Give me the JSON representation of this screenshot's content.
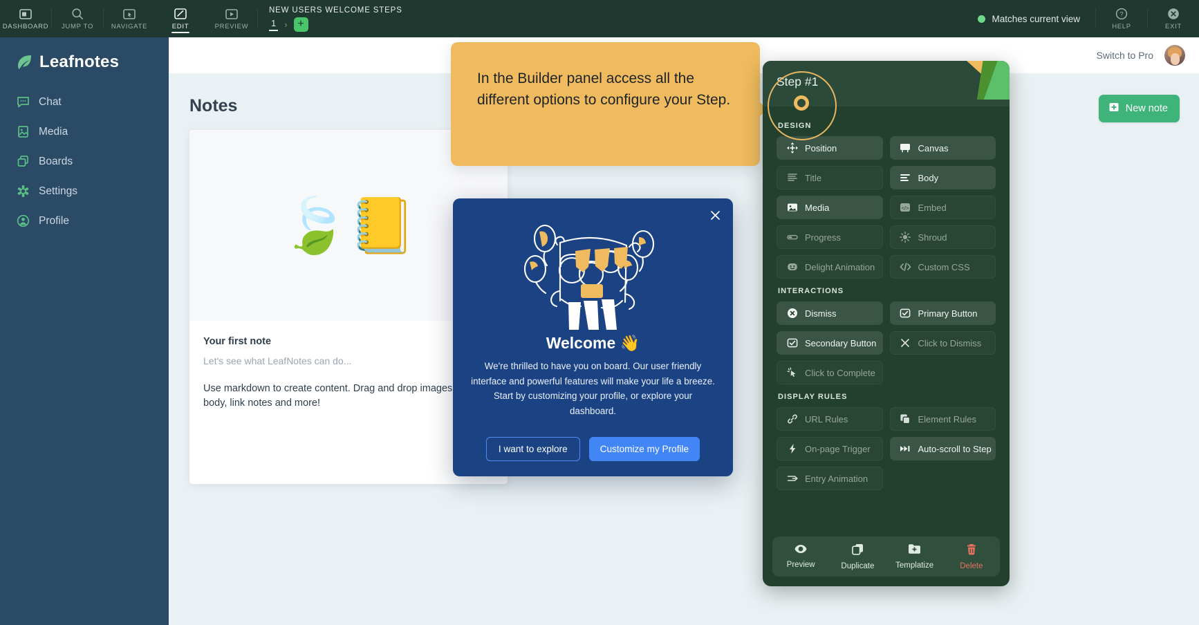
{
  "builder_bar": {
    "tools": [
      {
        "label": "DASHBOARD",
        "icon": "dashboard-icon",
        "active": false
      },
      {
        "label": "JUMP TO",
        "icon": "search-icon",
        "active": false
      },
      {
        "label": "NAVIGATE",
        "icon": "cursor-box-icon",
        "active": false
      },
      {
        "label": "EDIT",
        "icon": "pencil-box-icon",
        "active": true
      },
      {
        "label": "PREVIEW",
        "icon": "play-box-icon",
        "active": false
      }
    ],
    "flow_title": "NEW USERS WELCOME STEPS",
    "current_step": "1",
    "add_step_label": "+",
    "status_text": "Matches current view",
    "status_color": "#6fd88a",
    "help_label": "HELP",
    "exit_label": "EXIT"
  },
  "sidebar": {
    "brand": "Leafnotes",
    "items": [
      {
        "label": "Chat",
        "icon": "chat-icon"
      },
      {
        "label": "Media",
        "icon": "media-icon"
      },
      {
        "label": "Boards",
        "icon": "boards-icon"
      },
      {
        "label": "Settings",
        "icon": "settings-gear-icon"
      },
      {
        "label": "Profile",
        "icon": "profile-icon"
      }
    ]
  },
  "app_header": {
    "switch_to_pro": "Switch to Pro"
  },
  "main": {
    "page_title": "Notes",
    "new_note_label": "New note",
    "note_card": {
      "cover_emoji": "🍃📒",
      "title": "Your first note",
      "subtitle": "Let's see what LeafNotes can do...",
      "body": "Use markdown to create content. Drag and drop images in the body, link notes and more!"
    }
  },
  "callout": {
    "text": "In the Builder panel access all the different options to configure your Step.",
    "color": "#f0bb5e"
  },
  "welcome_modal": {
    "title": "Welcome 👋",
    "paragraph": "We're thrilled to have you on board. Our user friendly interface and powerful features will make your life a breeze. Start by customizing your profile, or explore your dashboard.",
    "secondary_button": "I want to explore",
    "primary_button": "Customize my Profile",
    "close_icon": "close-icon",
    "background": "#1b4384"
  },
  "builder_panel": {
    "step_label": "Step #1",
    "sections": [
      {
        "title": "DESIGN",
        "options": [
          {
            "label": "Position",
            "icon": "move-icon",
            "active": true
          },
          {
            "label": "Canvas",
            "icon": "canvas-icon",
            "active": true
          },
          {
            "label": "Title",
            "icon": "title-lines-icon",
            "active": false
          },
          {
            "label": "Body",
            "icon": "body-lines-icon",
            "active": true
          },
          {
            "label": "Media",
            "icon": "image-icon",
            "active": true
          },
          {
            "label": "Embed",
            "icon": "code-icon",
            "active": false
          },
          {
            "label": "Progress",
            "icon": "progress-icon",
            "active": false
          },
          {
            "label": "Shroud",
            "icon": "sun-icon",
            "active": false
          },
          {
            "label": "Delight Animation",
            "icon": "mask-icon",
            "active": false
          },
          {
            "label": "Custom CSS",
            "icon": "code-slash-icon",
            "active": false
          }
        ]
      },
      {
        "title": "INTERACTIONS",
        "options": [
          {
            "label": "Dismiss",
            "icon": "close-circle-icon",
            "active": true
          },
          {
            "label": "Primary Button",
            "icon": "checkbox-icon",
            "active": true
          },
          {
            "label": "Secondary Button",
            "icon": "checkbox-icon",
            "active": true
          },
          {
            "label": "Click to Dismiss",
            "icon": "x-icon",
            "active": false
          },
          {
            "label": "Click to Complete",
            "icon": "click-cursor-icon",
            "active": false
          }
        ]
      },
      {
        "title": "DISPLAY RULES",
        "options": [
          {
            "label": "URL Rules",
            "icon": "link-icon",
            "active": false
          },
          {
            "label": "Element Rules",
            "icon": "copy-icon",
            "active": false
          },
          {
            "label": "On-page Trigger",
            "icon": "bolt-icon",
            "active": false
          },
          {
            "label": "Auto-scroll to Step",
            "icon": "skip-forward-icon",
            "active": true
          },
          {
            "label": "Entry Animation",
            "icon": "arrow-in-icon",
            "active": false
          }
        ]
      }
    ],
    "footer_actions": [
      {
        "label": "Preview",
        "icon": "eye-icon",
        "danger": false
      },
      {
        "label": "Duplicate",
        "icon": "duplicate-icon",
        "danger": false
      },
      {
        "label": "Templatize",
        "icon": "template-add-icon",
        "danger": false
      },
      {
        "label": "Delete",
        "icon": "trash-icon",
        "danger": true
      }
    ]
  }
}
